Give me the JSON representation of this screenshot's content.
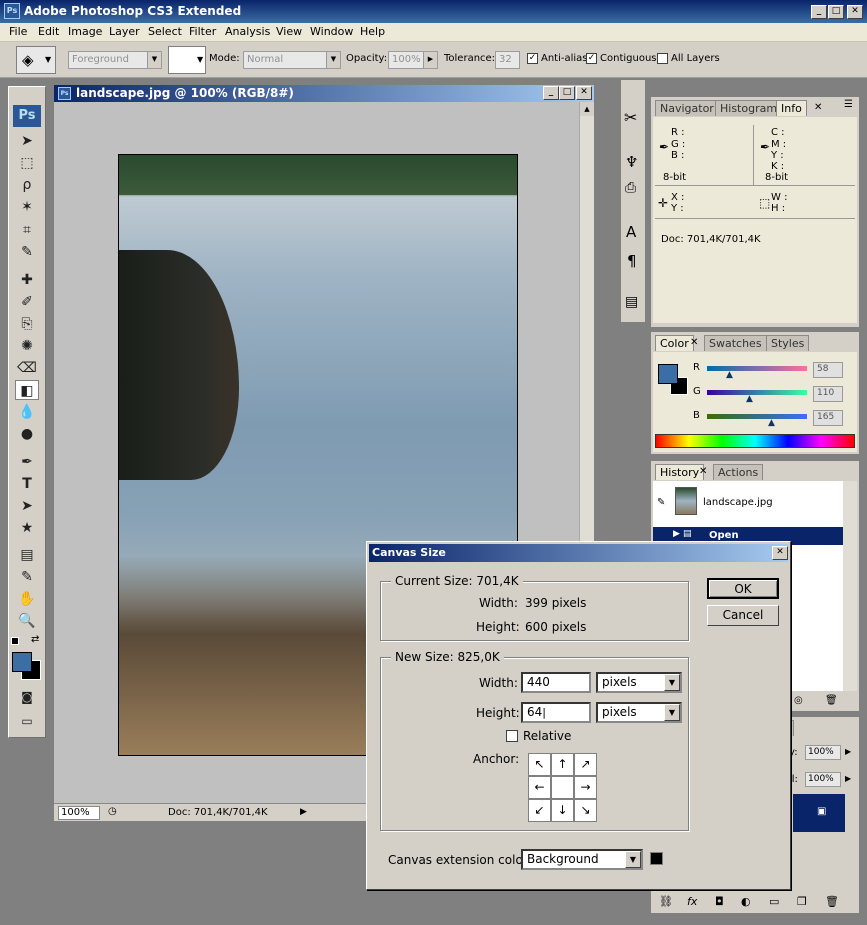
{
  "app": {
    "title": "Adobe Photoshop CS3 Extended",
    "logo": "Ps",
    "window_buttons": [
      "_",
      "□",
      "✕"
    ]
  },
  "menu": [
    "File",
    "Edit",
    "Image",
    "Layer",
    "Select",
    "Filter",
    "Analysis",
    "View",
    "Window",
    "Help"
  ],
  "options": {
    "fill_source": "Foreground",
    "mode_label": "Mode:",
    "mode_value": "Normal",
    "opacity_label": "Opacity:",
    "opacity_value": "100%",
    "tolerance_label": "Tolerance:",
    "tolerance_value": "32",
    "antialias_label": "Anti-alias",
    "contiguous_label": "Contiguous",
    "all_layers_label": "All Layers"
  },
  "tools": {
    "logo": "Ps",
    "glyphs": [
      "➤",
      "⬚",
      "ρ",
      "✶",
      "⌗",
      "✎",
      "✚",
      "✐",
      "⎘",
      "✺",
      "⌫",
      "◧",
      "💧",
      "●",
      "✒",
      "T",
      "➤",
      "★",
      "▤",
      "✎",
      "✋",
      "🔍"
    ]
  },
  "document": {
    "title": "landscape.jpg @ 100% (RGB/8#)",
    "zoom": "100%",
    "status": "Doc: 701,4K/701,4K"
  },
  "info_panel": {
    "tabs": [
      "Navigator",
      "Histogram",
      "Info"
    ],
    "rgb_labels": [
      "R :",
      "G :",
      "B :"
    ],
    "cmyk_labels": [
      "C :",
      "M :",
      "Y :",
      "K :"
    ],
    "bitdepth_left": "8-bit",
    "bitdepth_right": "8-bit",
    "xy_labels": [
      "X :",
      "Y :"
    ],
    "wh_labels": [
      "W :",
      "H :"
    ],
    "doc": "Doc: 701,4K/701,4K"
  },
  "color_panel": {
    "tabs": [
      "Color",
      "Swatches",
      "Styles"
    ],
    "channels": [
      {
        "label": "R",
        "value": "58",
        "pos": 0.23
      },
      {
        "label": "G",
        "value": "110",
        "pos": 0.43
      },
      {
        "label": "B",
        "value": "165",
        "pos": 0.65
      }
    ],
    "foreground": "#3a6ea5",
    "background": "#000000"
  },
  "history_panel": {
    "tabs": [
      "History",
      "Actions"
    ],
    "snapshot": "landscape.jpg",
    "step": "Open"
  },
  "layers_panel": {
    "tab_partial": "ns",
    "opacity_label": "y:",
    "opacity_value": "100%",
    "fill_label": "ll:",
    "fill_value": "100%"
  },
  "dialog": {
    "title": "Canvas Size",
    "current_legend": "Current Size: 701,4K",
    "current_width_label": "Width:",
    "current_width_value": "399 pixels",
    "current_height_label": "Height:",
    "current_height_value": "600 pixels",
    "new_legend": "New Size: 825,0K",
    "width_label": "Width:",
    "width_value": "440",
    "width_unit": "pixels",
    "height_label": "Height:",
    "height_value": "64",
    "height_unit": "pixels",
    "relative_label": "Relative",
    "anchor_label": "Anchor:",
    "anchor_arrows": [
      "↖",
      "↑",
      "↗",
      "←",
      "",
      "→",
      "↙",
      "↓",
      "↘"
    ],
    "ok_label": "OK",
    "cancel_label": "Cancel",
    "ext_color_label": "Canvas extension color:",
    "ext_color_value": "Background",
    "ext_swatch": "#000000"
  }
}
